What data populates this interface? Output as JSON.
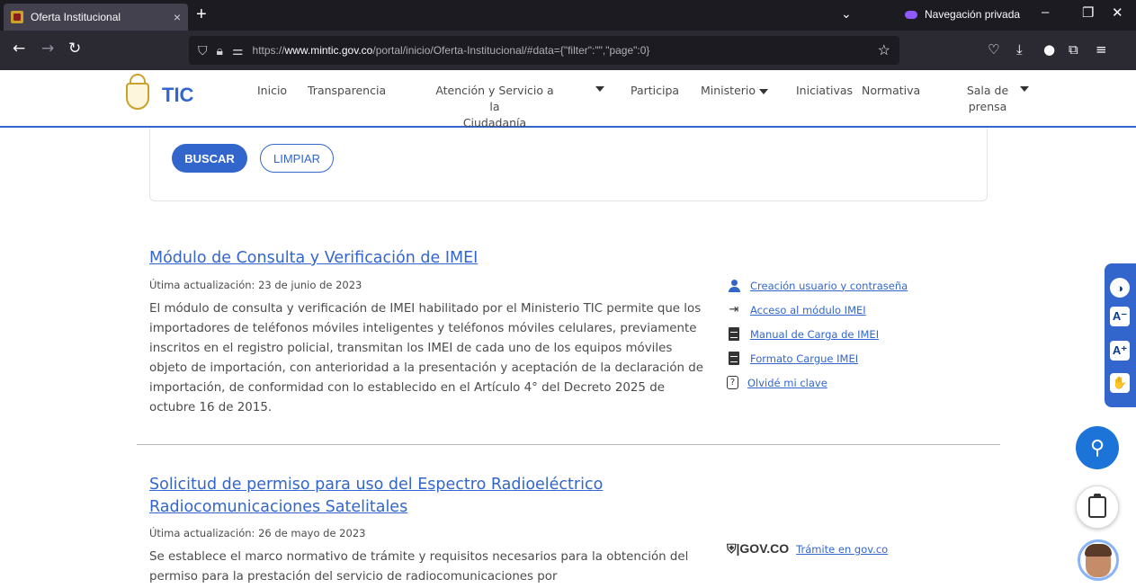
{
  "browser": {
    "tab_title": "Oferta Institucional",
    "tab_close": "×",
    "new_tab": "+",
    "private_label": "Navegación privada",
    "url_domain": "www.mintic.gov.co",
    "url_prefix": "https://",
    "url_path": "/portal/inicio/Oferta-Institucional/#data={\"filter\":\"\",\"page\":0}"
  },
  "header": {
    "logo_text": "TIC",
    "menu": [
      {
        "label": "Inicio"
      },
      {
        "label": "Transparencia"
      },
      {
        "label": "Atención y Servicio a la\nCiudadanía"
      },
      {
        "label": "Participa"
      },
      {
        "label": "Ministerio"
      },
      {
        "label": "Iniciativas"
      },
      {
        "label": "Normativa"
      },
      {
        "label": "Sala de\nprensa"
      }
    ]
  },
  "search": {
    "buscar_label": "BUSCAR",
    "limpiar_label": "LIMPIAR"
  },
  "items": [
    {
      "title": "Módulo de Consulta y Verificación de IMEI",
      "date": "Útima actualización: 23 de junio de 2023",
      "description": "El módulo de consulta y verificación de IMEI habilitado por el Ministerio TIC permite que los importadores de teléfonos móviles inteligentes y teléfonos móviles celulares, previamente inscritos en el registro policial, transmitan los IMEI de cada uno de los equipos móviles objeto de importación, con anterioridad a la presentación y aceptación de la declaración de importación, de conformidad con lo establecido en el Artículo 4° del Decreto 2025 de octubre 16 de 2015.",
      "links": [
        {
          "label": "Creación usuario y contraseña",
          "icon": "user-icon"
        },
        {
          "label": "Acceso al módulo IMEI",
          "icon": "login-icon"
        },
        {
          "label": "Manual de Carga de IMEI",
          "icon": "document-icon"
        },
        {
          "label": "Formato Cargue IMEI",
          "icon": "document-icon"
        },
        {
          "label": "Olvidé mi clave",
          "icon": "help-icon"
        }
      ]
    },
    {
      "title_line1": "Solicitud de permiso para uso del Espectro Radioeléctrico",
      "title_line2": "Radiocomunicaciones Satelitales",
      "date": "Útima actualización: 26 de mayo de 2023",
      "description": "Se establece el marco normativo de trámite y requisitos necesarios para la obtención del permiso para la prestación del servicio de radiocomunicaciones por",
      "gov_logo": "GOV.CO",
      "gov_link": "Trámite en gov.co"
    }
  ],
  "colors": {
    "accent": "#3366cc",
    "text": "#4b4b4b"
  }
}
